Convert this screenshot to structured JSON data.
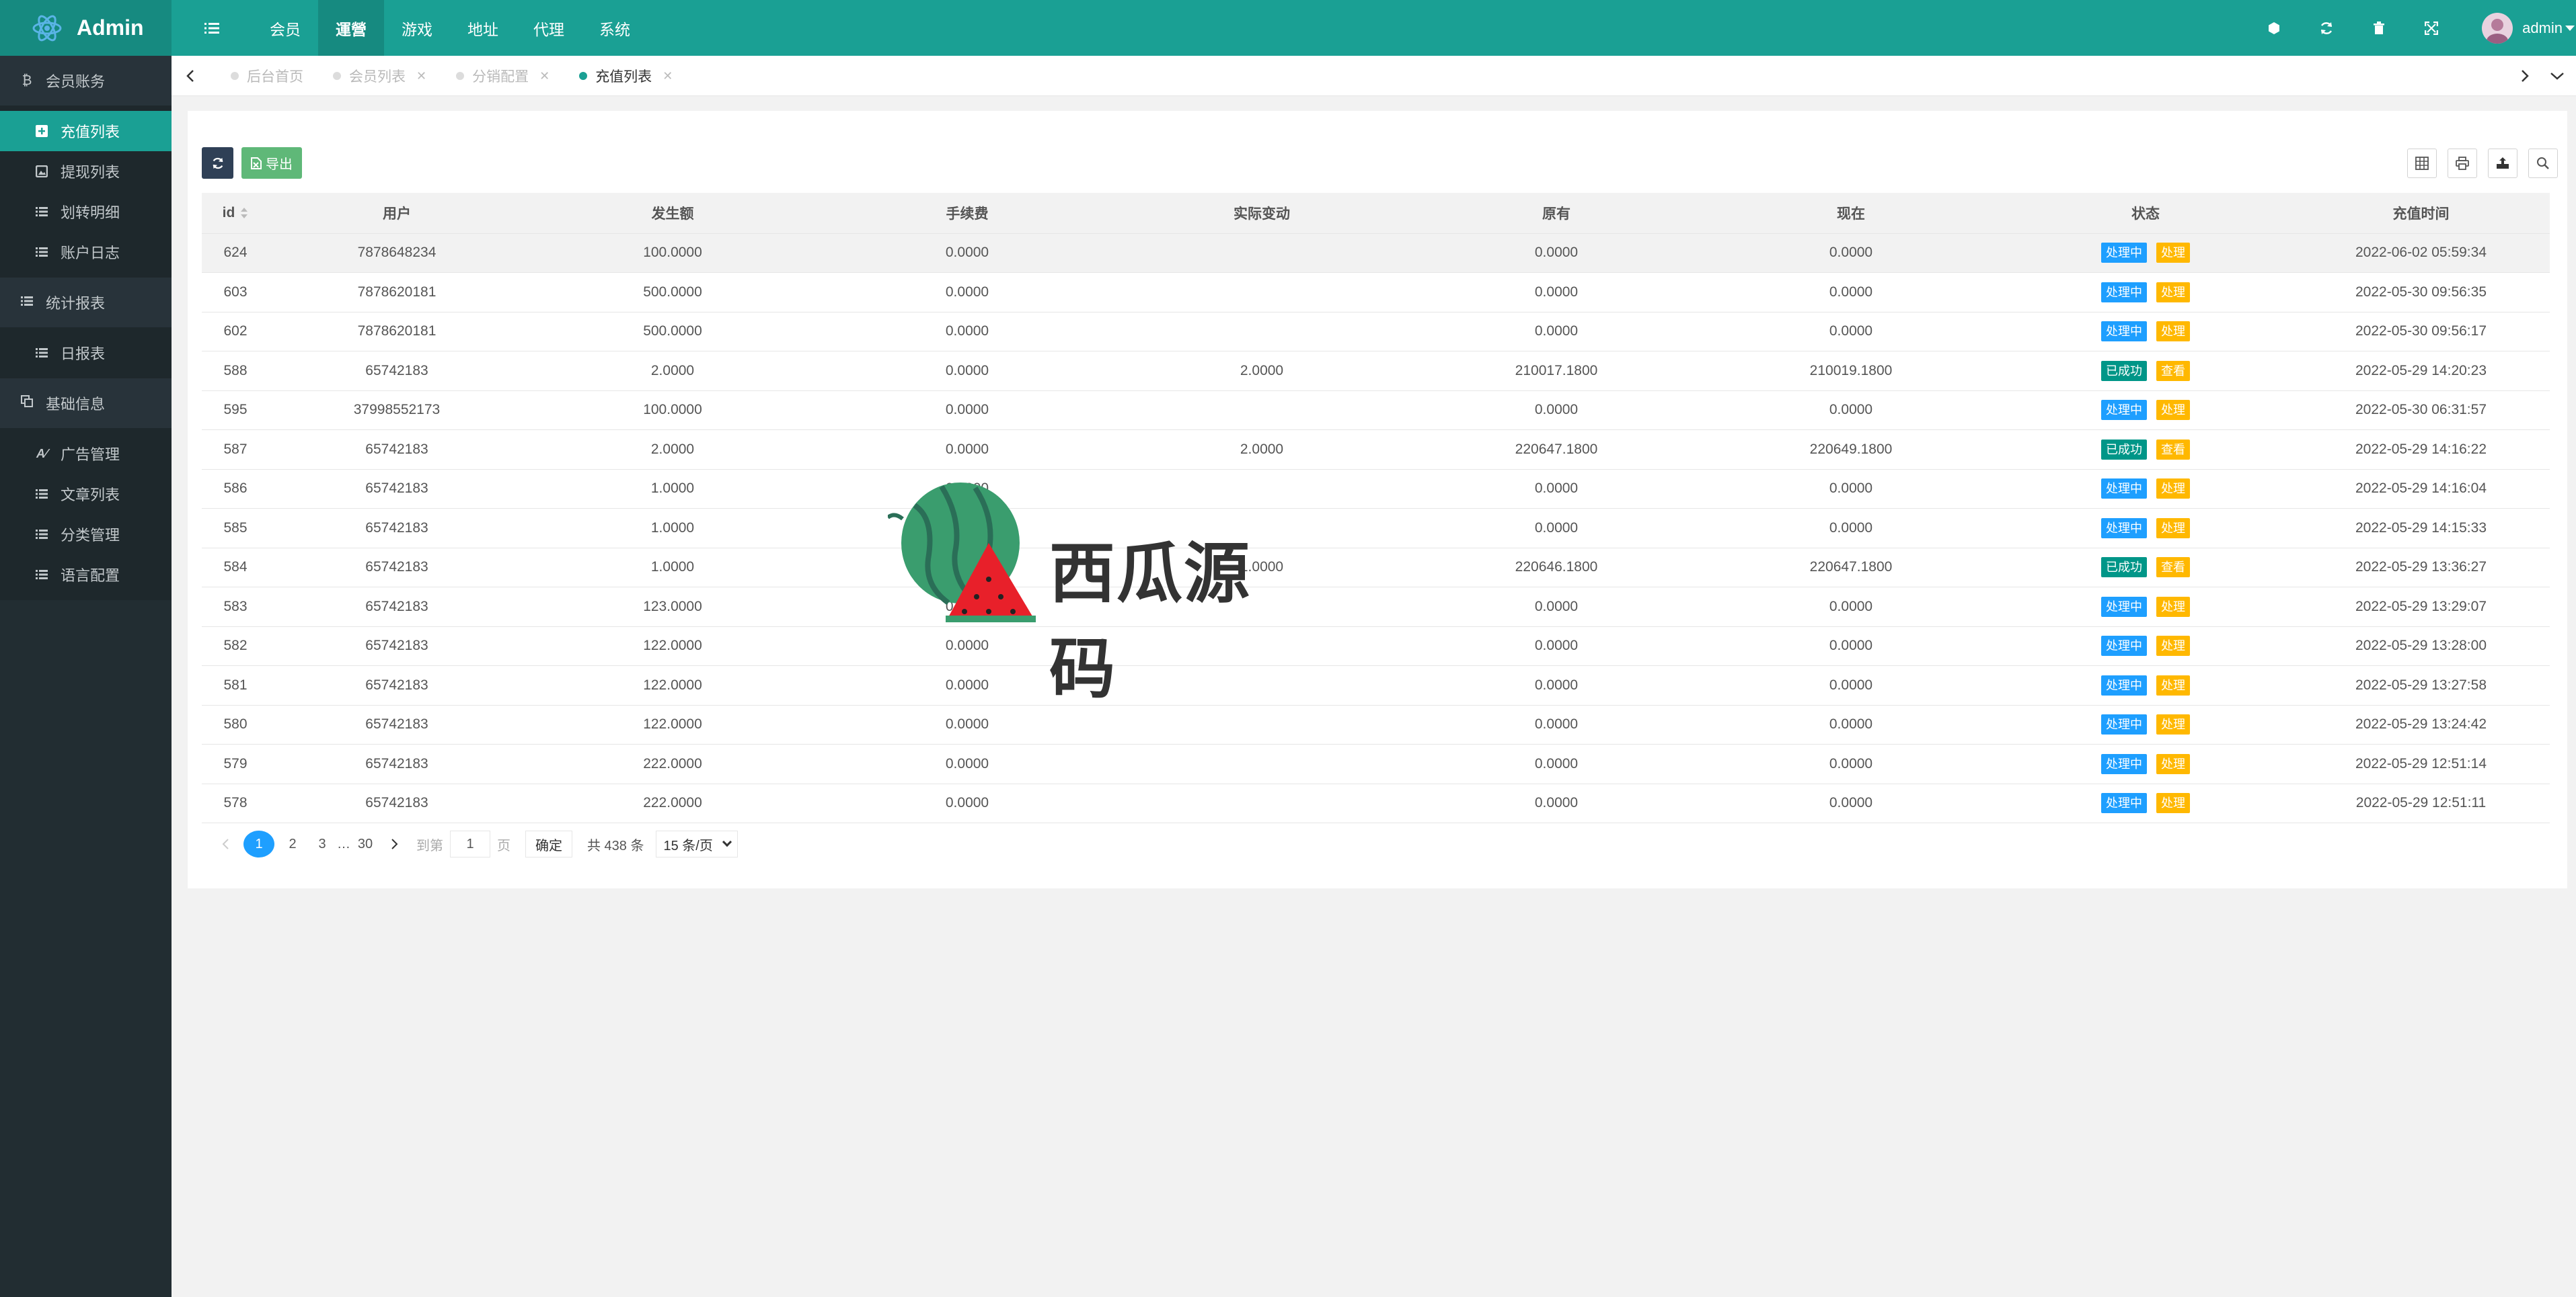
{
  "app": {
    "logo_text": "Admin",
    "brand_color": "#1aa094",
    "sidebar_color": "#222d32"
  },
  "topnav": {
    "items": [
      {
        "label": "会员",
        "active": false
      },
      {
        "label": "運營",
        "active": true
      },
      {
        "label": "游戏",
        "active": false
      },
      {
        "label": "地址",
        "active": false
      },
      {
        "label": "代理",
        "active": false
      },
      {
        "label": "系统",
        "active": false
      }
    ],
    "user_name": "admin"
  },
  "sidebar": {
    "groups": [
      {
        "label": "会员账务",
        "icon": "bitcoin-icon",
        "items": [
          {
            "label": "充值列表",
            "icon": "plus-square-icon",
            "active": true
          },
          {
            "label": "提现列表",
            "icon": "image-icon",
            "active": false
          },
          {
            "label": "划转明细",
            "icon": "list-icon",
            "active": false
          },
          {
            "label": "账户日志",
            "icon": "list-icon",
            "active": false
          }
        ]
      },
      {
        "label": "统计报表",
        "icon": "list-icon",
        "items": [
          {
            "label": "日报表",
            "icon": "list-icon",
            "active": false
          }
        ]
      },
      {
        "label": "基础信息",
        "icon": "copy-icon",
        "items": [
          {
            "label": "广告管理",
            "icon": "font-icon",
            "active": false
          },
          {
            "label": "文章列表",
            "icon": "list-icon",
            "active": false
          },
          {
            "label": "分类管理",
            "icon": "list-icon",
            "active": false
          },
          {
            "label": "语言配置",
            "icon": "list-icon",
            "active": false
          }
        ]
      }
    ]
  },
  "tabs": [
    {
      "label": "后台首页",
      "active": false,
      "closable": false
    },
    {
      "label": "会员列表",
      "active": false,
      "closable": true
    },
    {
      "label": "分销配置",
      "active": false,
      "closable": true
    },
    {
      "label": "充值列表",
      "active": true,
      "closable": true
    }
  ],
  "toolbar": {
    "export_label": "导出"
  },
  "table": {
    "columns": [
      "id",
      "用户",
      "发生额",
      "手续费",
      "实际变动",
      "原有",
      "现在",
      "状态",
      "充值时间"
    ],
    "rows": [
      {
        "id": "624",
        "user": "7878648234",
        "amount": "100.0000",
        "fee": "0.0000",
        "change": "",
        "before": "0.0000",
        "after": "0.0000",
        "status": "处理中",
        "action": "处理",
        "time": "2022-06-02 05:59:34"
      },
      {
        "id": "603",
        "user": "7878620181",
        "amount": "500.0000",
        "fee": "0.0000",
        "change": "",
        "before": "0.0000",
        "after": "0.0000",
        "status": "处理中",
        "action": "处理",
        "time": "2022-05-30 09:56:35"
      },
      {
        "id": "602",
        "user": "7878620181",
        "amount": "500.0000",
        "fee": "0.0000",
        "change": "",
        "before": "0.0000",
        "after": "0.0000",
        "status": "处理中",
        "action": "处理",
        "time": "2022-05-30 09:56:17"
      },
      {
        "id": "588",
        "user": "65742183",
        "amount": "2.0000",
        "fee": "0.0000",
        "change": "2.0000",
        "before": "210017.1800",
        "after": "210019.1800",
        "status": "已成功",
        "action": "查看",
        "time": "2022-05-29 14:20:23"
      },
      {
        "id": "595",
        "user": "37998552173",
        "amount": "100.0000",
        "fee": "0.0000",
        "change": "",
        "before": "0.0000",
        "after": "0.0000",
        "status": "处理中",
        "action": "处理",
        "time": "2022-05-30 06:31:57"
      },
      {
        "id": "587",
        "user": "65742183",
        "amount": "2.0000",
        "fee": "0.0000",
        "change": "2.0000",
        "before": "220647.1800",
        "after": "220649.1800",
        "status": "已成功",
        "action": "查看",
        "time": "2022-05-29 14:16:22"
      },
      {
        "id": "586",
        "user": "65742183",
        "amount": "1.0000",
        "fee": "0.0000",
        "change": "",
        "before": "0.0000",
        "after": "0.0000",
        "status": "处理中",
        "action": "处理",
        "time": "2022-05-29 14:16:04"
      },
      {
        "id": "585",
        "user": "65742183",
        "amount": "1.0000",
        "fee": "0.0000",
        "change": "",
        "before": "0.0000",
        "after": "0.0000",
        "status": "处理中",
        "action": "处理",
        "time": "2022-05-29 14:15:33"
      },
      {
        "id": "584",
        "user": "65742183",
        "amount": "1.0000",
        "fee": "0.0000",
        "change": "1.0000",
        "before": "220646.1800",
        "after": "220647.1800",
        "status": "已成功",
        "action": "查看",
        "time": "2022-05-29 13:36:27"
      },
      {
        "id": "583",
        "user": "65742183",
        "amount": "123.0000",
        "fee": "0.0000",
        "change": "",
        "before": "0.0000",
        "after": "0.0000",
        "status": "处理中",
        "action": "处理",
        "time": "2022-05-29 13:29:07"
      },
      {
        "id": "582",
        "user": "65742183",
        "amount": "122.0000",
        "fee": "0.0000",
        "change": "",
        "before": "0.0000",
        "after": "0.0000",
        "status": "处理中",
        "action": "处理",
        "time": "2022-05-29 13:28:00"
      },
      {
        "id": "581",
        "user": "65742183",
        "amount": "122.0000",
        "fee": "0.0000",
        "change": "",
        "before": "0.0000",
        "after": "0.0000",
        "status": "处理中",
        "action": "处理",
        "time": "2022-05-29 13:27:58"
      },
      {
        "id": "580",
        "user": "65742183",
        "amount": "122.0000",
        "fee": "0.0000",
        "change": "",
        "before": "0.0000",
        "after": "0.0000",
        "status": "处理中",
        "action": "处理",
        "time": "2022-05-29 13:24:42"
      },
      {
        "id": "579",
        "user": "65742183",
        "amount": "222.0000",
        "fee": "0.0000",
        "change": "",
        "before": "0.0000",
        "after": "0.0000",
        "status": "处理中",
        "action": "处理",
        "time": "2022-05-29 12:51:14"
      },
      {
        "id": "578",
        "user": "65742183",
        "amount": "222.0000",
        "fee": "0.0000",
        "change": "",
        "before": "0.0000",
        "after": "0.0000",
        "status": "处理中",
        "action": "处理",
        "time": "2022-05-29 12:51:11"
      }
    ]
  },
  "pager": {
    "pages": [
      "1",
      "2",
      "3",
      "…",
      "30"
    ],
    "current": "1",
    "goto_prefix": "到第",
    "goto_value": "1",
    "goto_suffix": "页",
    "confirm_label": "确定",
    "total": "共 438 条",
    "page_size": "15 条/页"
  },
  "watermark": {
    "text": "西瓜源码"
  }
}
